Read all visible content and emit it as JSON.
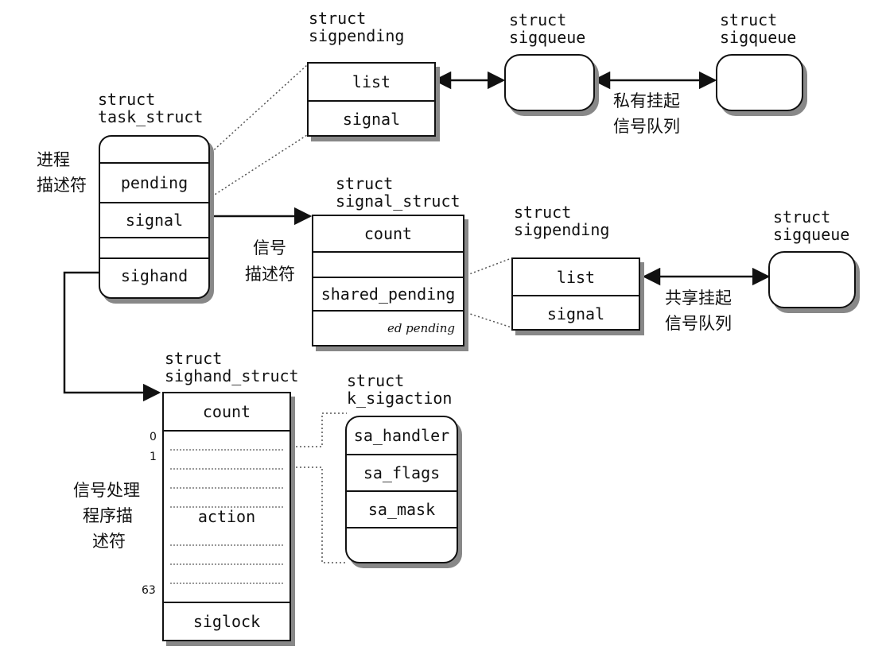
{
  "labels": {
    "task_struct": "struct\ntask_struct",
    "sigpending_top": "struct\nsigpending",
    "sigqueue_1": "struct\nsigqueue",
    "sigqueue_2": "struct\nsigqueue",
    "signal_struct": "struct\nsignal_struct",
    "sigpending_shared": "struct\nsigpending",
    "sigqueue_shared": "struct\nsigqueue",
    "sighand_struct": "struct\nsighand_struct",
    "k_sigaction": "struct\nk_sigaction"
  },
  "chinese": {
    "process_desc_1": "进程",
    "process_desc_2": "描述符",
    "private_queue_1": "私有挂起",
    "private_queue_2": "信号队列",
    "signal_desc_1": "信号",
    "signal_desc_2": "描述符",
    "shared_queue_1": "共享挂起",
    "shared_queue_2": "信号队列",
    "handler_desc_1": "信号处理",
    "handler_desc_2": "程序描",
    "handler_desc_3": "述符"
  },
  "task_struct_fields": {
    "pending": "pending",
    "signal": "signal",
    "sighand": "sighand"
  },
  "sigpending_top_fields": {
    "list": "list",
    "signal": "signal"
  },
  "signal_struct_fields": {
    "count": "count",
    "shared_pending": "shared_pending",
    "ed_pending": "ed pending"
  },
  "sigpending_shared_fields": {
    "list": "list",
    "signal": "signal"
  },
  "sighand_fields": {
    "count": "count",
    "action": "action",
    "siglock": "siglock",
    "idx0": "0",
    "idx1": "1",
    "idx63": "63"
  },
  "k_sigaction_fields": {
    "sa_handler": "sa_handler",
    "sa_flags": "sa_flags",
    "sa_mask": "sa_mask"
  }
}
